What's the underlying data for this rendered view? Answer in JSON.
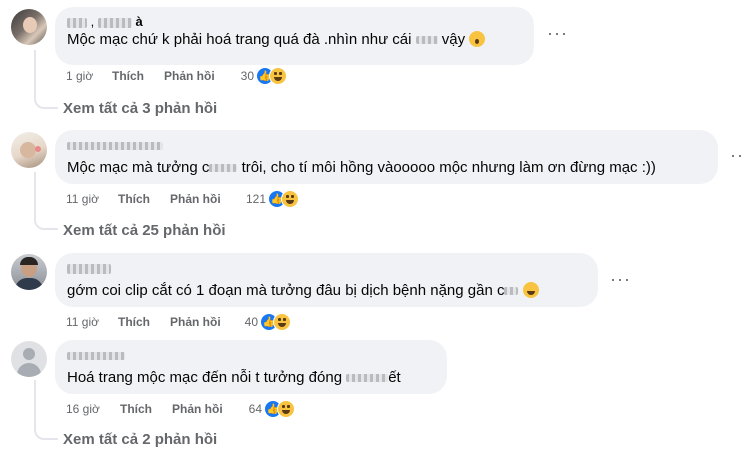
{
  "comments": [
    {
      "author_suffix": "à",
      "text": "Mộc mạc chứ k phải hoá trang quá đà .nhìn như cái",
      "text_tail": "vậy",
      "time": "1 giờ",
      "like_label": "Thích",
      "reply_label": "Phản hồi",
      "reaction_count": "30",
      "view_replies": "Xem tất cả 3 phản hồi"
    },
    {
      "text": "Mộc mạc mà tưởng c",
      "text_tail": "trôi, cho tí môi hồng vàooooo mộc nhưng làm ơn đừng mạc :))",
      "time": "11 giờ",
      "like_label": "Thích",
      "reply_label": "Phản hồi",
      "reaction_count": "121",
      "view_replies": "Xem tất cả 25 phản hồi"
    },
    {
      "text": "gớm coi clip cắt có 1 đoạn mà tưởng đâu bị dịch bệnh nặng gần c",
      "time": "11 giờ",
      "like_label": "Thích",
      "reply_label": "Phản hồi",
      "reaction_count": "40"
    },
    {
      "text": "Hoá trang mộc mạc đến nỗi t tưởng đóng",
      "text_tail": "ết",
      "time": "16 giờ",
      "like_label": "Thích",
      "reply_label": "Phản hồi",
      "reaction_count": "64",
      "view_replies": "Xem tất cả 2 phản hồi"
    }
  ],
  "more_label": "···",
  "colors": {
    "like_blue": "#1877f2",
    "haha_yellow": "#f7c341",
    "bubble_bg": "#f0f2f5",
    "muted": "#65676b"
  }
}
